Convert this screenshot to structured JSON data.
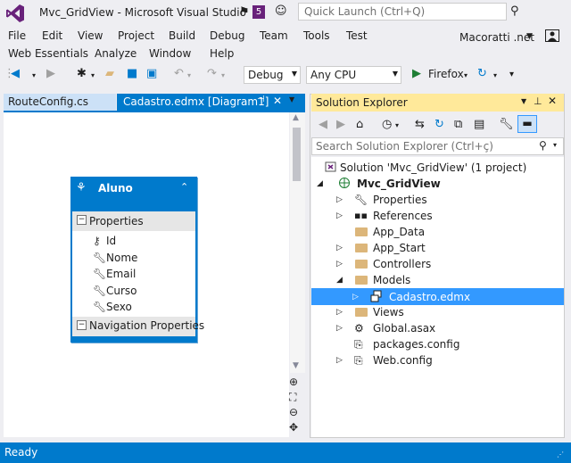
{
  "window": {
    "title": "Mvc_GridView - Microsoft Visual Studio",
    "notifications_count": "5",
    "quick_launch_placeholder": "Quick Launch (Ctrl+Q)",
    "account": "Macoratti .net"
  },
  "menu": {
    "row1": [
      "File",
      "Edit",
      "View",
      "Project",
      "Build",
      "Debug",
      "Team",
      "Tools",
      "Test"
    ],
    "row2": [
      "Web Essentials",
      "Analyze",
      "Window",
      "Help"
    ]
  },
  "toolbar": {
    "configuration": "Debug",
    "platform": "Any CPU",
    "run_target": "Firefox"
  },
  "tabs": [
    {
      "label": "RouteConfig.cs",
      "active": false
    },
    {
      "label": "Cadastro.edmx [Diagram1]",
      "active": true
    }
  ],
  "entity": {
    "name": "Aluno",
    "properties_label": "Properties",
    "properties": [
      "Id",
      "Nome",
      "Email",
      "Curso",
      "Sexo"
    ],
    "navigation_label": "Navigation Properties"
  },
  "solution_explorer": {
    "title": "Solution Explorer",
    "search_placeholder": "Search Solution Explorer (Ctrl+ç)",
    "solution_label": "Solution 'Mvc_GridView' (1 project)",
    "project": "Mvc_GridView",
    "items": [
      {
        "label": "Properties",
        "icon": "wrench-icon"
      },
      {
        "label": "References",
        "icon": "references-icon"
      },
      {
        "label": "App_Data",
        "icon": "folder-icon"
      },
      {
        "label": "App_Start",
        "icon": "folder-icon"
      },
      {
        "label": "Controllers",
        "icon": "folder-icon"
      },
      {
        "label": "Models",
        "icon": "folder-icon"
      },
      {
        "label": "Cadastro.edmx",
        "icon": "edmx-icon",
        "selected": true
      },
      {
        "label": "Views",
        "icon": "folder-icon"
      },
      {
        "label": "Global.asax",
        "icon": "global-asax-icon"
      },
      {
        "label": "packages.config",
        "icon": "config-icon"
      },
      {
        "label": "Web.config",
        "icon": "config-icon"
      }
    ]
  },
  "status": {
    "text": "Ready"
  },
  "colors": {
    "accent": "#007acc",
    "vs_purple": "#68217a",
    "se_title": "#ffe99a",
    "selection": "#3399ff",
    "folder": "#dcb67a"
  }
}
